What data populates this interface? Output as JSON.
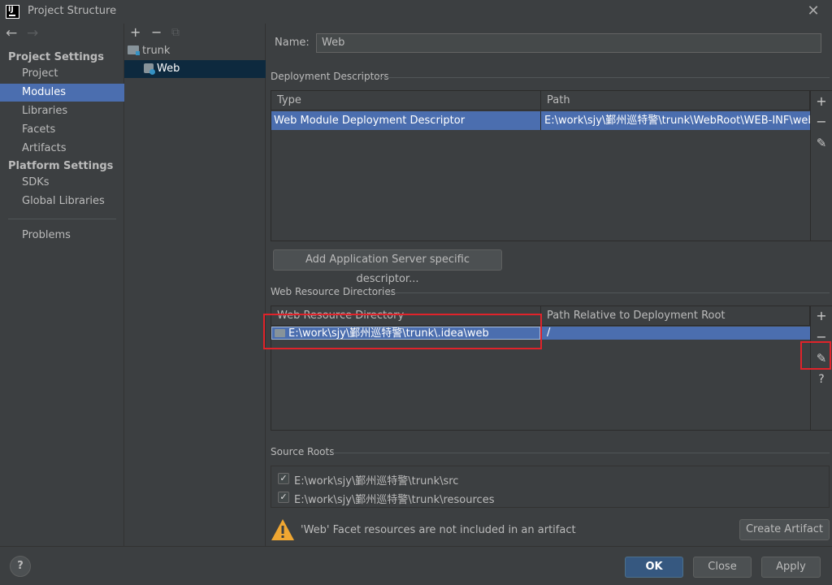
{
  "window": {
    "title": "Project Structure",
    "app_icon_text": "IJ"
  },
  "nav": {
    "back": "←",
    "forward": "→",
    "project_settings": "Project Settings",
    "items_project": [
      {
        "label": "Project"
      },
      {
        "label": "Modules"
      },
      {
        "label": "Libraries"
      },
      {
        "label": "Facets"
      },
      {
        "label": "Artifacts"
      }
    ],
    "platform_settings": "Platform Settings",
    "items_platform": [
      {
        "label": "SDKs"
      },
      {
        "label": "Global Libraries"
      }
    ],
    "problems": "Problems",
    "selected": "Modules"
  },
  "tree": {
    "toolbar": {
      "add": "+",
      "remove": "−",
      "copy": "⧉"
    },
    "nodes": [
      {
        "label": "trunk"
      },
      {
        "label": "Web"
      }
    ]
  },
  "main": {
    "name_label": "Name:",
    "name_value": "Web",
    "deployment": {
      "title": "Deployment Descriptors",
      "columns": [
        "Type",
        "Path"
      ],
      "rows": [
        {
          "type": "Web Module Deployment Descriptor",
          "path": "E:\\work\\sjy\\鄞州巡特警\\trunk\\WebRoot\\WEB-INF\\web.xml"
        }
      ],
      "add_server_button": "Add Application Server specific descriptor..."
    },
    "web_resources": {
      "title": "Web Resource Directories",
      "columns": [
        "Web Resource Directory",
        "Path Relative to Deployment Root"
      ],
      "rows": [
        {
          "dir": "E:\\work\\sjy\\鄞州巡特警\\trunk\\.idea\\web",
          "path": "/"
        }
      ]
    },
    "source_roots": {
      "title": "Source Roots",
      "items": [
        {
          "label": "E:\\work\\sjy\\鄞州巡特警\\trunk\\src",
          "checked": true
        },
        {
          "label": "E:\\work\\sjy\\鄞州巡特警\\trunk\\resources",
          "checked": true
        }
      ]
    },
    "warning": "'Web' Facet resources are not included in an artifact",
    "create_artifact": "Create Artifact",
    "tools": {
      "add": "+",
      "remove": "−",
      "edit": "✎",
      "help": "?"
    }
  },
  "footer": {
    "help": "?",
    "ok": "OK",
    "close": "Close",
    "apply": "Apply"
  },
  "colors": {
    "selection": "#4b6eaf",
    "highlight_box": "#e0232a",
    "warning": "#f0a732"
  }
}
